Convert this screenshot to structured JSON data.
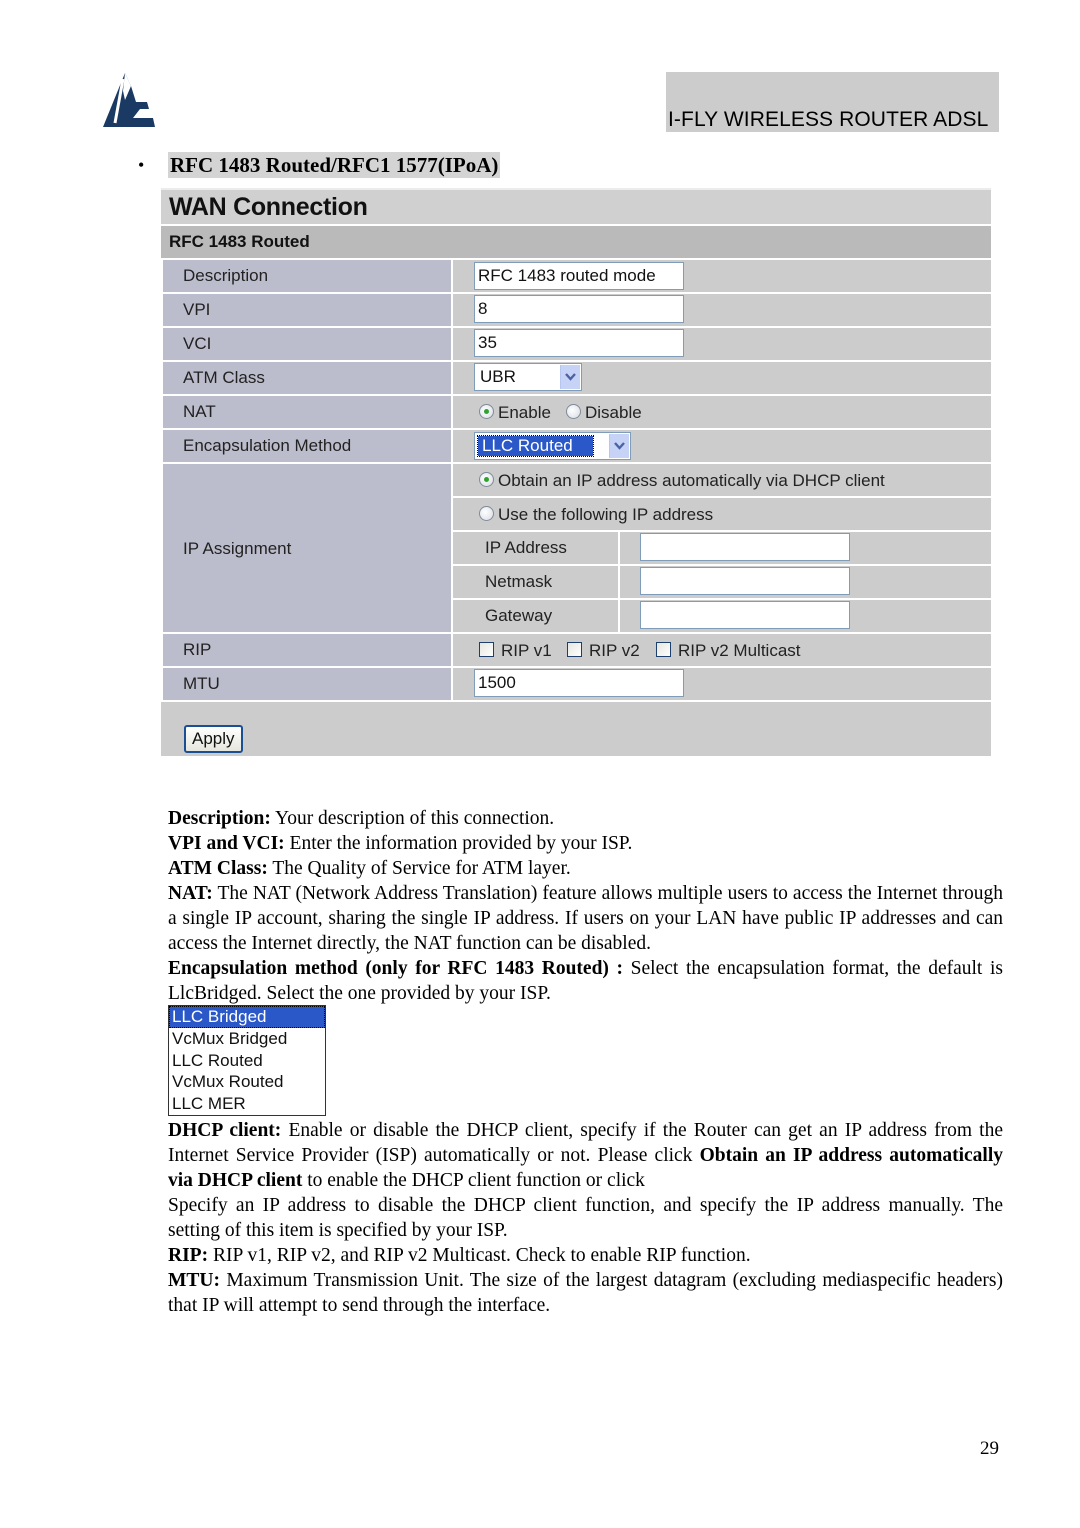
{
  "header": {
    "logo_icon": "atlantis-a-logo-icon",
    "product_title": "I-FLY WIRELESS ROUTER ADSL"
  },
  "section": {
    "bullet": "•",
    "title": "RFC 1483 Routed/RFC1 1577(IPoA)"
  },
  "wan_form": {
    "title": "WAN Connection",
    "subtitle": "RFC 1483 Routed",
    "description": {
      "label": "Description",
      "value": "RFC 1483 routed mode"
    },
    "vpi": {
      "label": "VPI",
      "value": "8"
    },
    "vci": {
      "label": "VCI",
      "value": "35"
    },
    "atm_class": {
      "label": "ATM Class",
      "value": "UBR"
    },
    "nat": {
      "label": "NAT",
      "options": [
        "Enable",
        "Disable"
      ],
      "selected": "Enable"
    },
    "encapsulation": {
      "label": "Encapsulation Method",
      "value": "LLC Routed"
    },
    "ip_assignment": {
      "label": "IP Assignment",
      "option_dhcp": "Obtain an IP address automatically via DHCP client",
      "option_static": "Use the following IP address",
      "selected": "Obtain an IP address automatically via DHCP client",
      "ip_address": {
        "label": "IP Address",
        "value": ""
      },
      "netmask": {
        "label": "Netmask",
        "value": ""
      },
      "gateway": {
        "label": "Gateway",
        "value": ""
      }
    },
    "rip": {
      "label": "RIP",
      "options": [
        "RIP v1",
        "RIP v2",
        "RIP v2 Multicast"
      ],
      "checked": []
    },
    "mtu": {
      "label": "MTU",
      "value": "1500"
    },
    "apply_label": "Apply"
  },
  "doc": {
    "description": {
      "term": "Description:",
      "text": " Your description of this connection."
    },
    "vpi_vci": {
      "term": "VPI and VCI:",
      "text": " Enter the information provided by your ISP."
    },
    "atm_class": {
      "term": "ATM Class:",
      "text": " The Quality of Service for ATM layer."
    },
    "nat": {
      "term": "NAT:",
      "text": " The NAT (Network Address Translation) feature allows multiple users to access the Internet through a single IP account, sharing the single IP address. If users on your LAN have public IP addresses and can access the Internet directly, the NAT function can be disabled."
    },
    "encapsulation": {
      "term": "Encapsulation method (only for RFC 1483 Routed) :",
      "text": " Select the encapsulation format, the default is LlcBridged. Select the one provided by your ISP."
    },
    "encapsulation_options": [
      "LLC Bridged",
      "VcMux Bridged",
      "LLC Routed",
      "VcMux Routed",
      "LLC MER"
    ],
    "encapsulation_selected": "LLC Bridged",
    "dhcp": {
      "term": "DHCP client:",
      "text1": " Enable or disable the DHCP client, specify if the Router can get an IP address from the Internet Service Provider (ISP) automatically or not. Please click ",
      "bold": "Obtain an IP address automatically via DHCP client",
      "text2": " to enable the DHCP client function or click"
    },
    "specify": "Specify an IP address to disable the DHCP client function, and specify the IP address manually. The setting of this item is specified by your ISP.",
    "rip": {
      "term": "RIP:",
      "text": " RIP v1, RIP v2, and RIP v2 Multicast. Check to enable RIP function."
    },
    "mtu": {
      "term": "MTU:",
      "text": " Maximum Transmission Unit. The size of the largest datagram (excluding mediaspecific headers) that IP will attempt to send through the interface."
    }
  },
  "page_number": "29",
  "colors": {
    "logo": "#1b3a63",
    "label_cell": "#bcbdcc",
    "value_cell": "#cccccc",
    "subheader": "#bababa",
    "selection": "#2a58c9"
  }
}
